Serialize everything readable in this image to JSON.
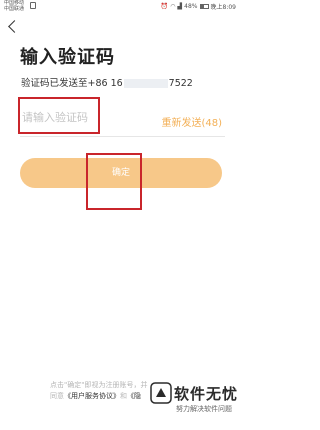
{
  "status_bar": {
    "carrier_1": "中国移动",
    "carrier_2": "中国联通",
    "battery": "48%",
    "time": "晚上8:09",
    "icons": [
      "sim-icon",
      "alarm-icon",
      "wifi-icon",
      "signal-icon",
      "battery-icon"
    ]
  },
  "header": {
    "back_icon": "chevron-left-icon",
    "title": "输入验证码"
  },
  "verify": {
    "sent_prefix": "验证码已发送至+86 16",
    "sent_suffix": "7522",
    "code_placeholder": "请输入验证码",
    "resend_label": "重新发送(48)",
    "confirm_label": "确定"
  },
  "footer": {
    "line1": "点击\"确定\"即视为注册账号，并",
    "line2_prefix": "同意",
    "user_agreement": "《用户服务协议》",
    "line2_mid": "和",
    "privacy_partial": "《隐"
  },
  "watermark": {
    "title": "软件无忧",
    "subtitle": "努力解决软件问题"
  },
  "colors": {
    "accent_orange": "#f3b057",
    "button_fill": "#f7c889",
    "annotation_red": "#c9252b"
  }
}
